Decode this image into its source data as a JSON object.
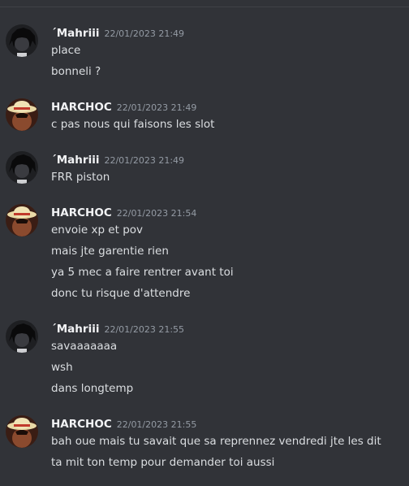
{
  "colors": {
    "background": "#313338",
    "divider": "#3f4147",
    "author": "#f2f3f5",
    "timestamp": "#949ba4",
    "message": "#dbdee1"
  },
  "messages": [
    {
      "author": "´Mahriii",
      "timestamp": "22/01/2023 21:49",
      "avatar_icon": "dark-hair-avatar-icon",
      "lines": [
        "place",
        "bonneli ?"
      ]
    },
    {
      "author": "HARCHOC",
      "timestamp": "22/01/2023 21:49",
      "avatar_icon": "straw-hat-avatar-icon",
      "lines": [
        "c pas nous qui faisons les slot"
      ]
    },
    {
      "author": "´Mahriii",
      "timestamp": "22/01/2023 21:49",
      "avatar_icon": "dark-hair-avatar-icon",
      "lines": [
        "FRR piston"
      ]
    },
    {
      "author": "HARCHOC",
      "timestamp": "22/01/2023 21:54",
      "avatar_icon": "straw-hat-avatar-icon",
      "lines": [
        "envoie xp et pov",
        "mais jte garentie rien",
        "ya 5 mec a faire rentrer avant toi",
        "donc tu risque d'attendre"
      ]
    },
    {
      "author": "´Mahriii",
      "timestamp": "22/01/2023 21:55",
      "avatar_icon": "dark-hair-avatar-icon",
      "lines": [
        "savaaaaaaa",
        "wsh",
        "dans longtemp"
      ]
    },
    {
      "author": "HARCHOC",
      "timestamp": "22/01/2023 21:55",
      "avatar_icon": "straw-hat-avatar-icon",
      "lines": [
        "bah oue mais tu savait que sa reprennez vendredi jte les dit",
        "ta mit ton temp pour demander toi aussi"
      ]
    }
  ]
}
